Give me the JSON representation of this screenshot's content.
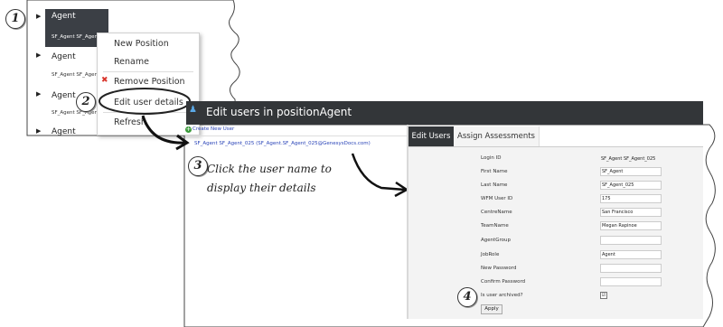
{
  "steps": {
    "one": "1",
    "two": "2",
    "three": "3",
    "four": "4"
  },
  "tree": {
    "items": [
      {
        "label": "Agent",
        "sub": "SF_Agent SF_Agent"
      },
      {
        "label": "Agent",
        "sub": "SF_Agent SF_Agent"
      },
      {
        "label": "Agent",
        "sub": "SF_Agent SF_Agent"
      },
      {
        "label": "Agent"
      }
    ]
  },
  "context_menu": {
    "items": [
      "New Position",
      "Rename",
      "Remove Position",
      "Edit user details",
      "Refresh"
    ]
  },
  "dialog": {
    "title": "Edit users in positionAgent",
    "create_user": "Create New User",
    "user_link": "SF_Agent SF_Agent_025 (SF_Agent.SF_Agent_025@GenesysDocs.com)",
    "tabs": [
      "Edit Users",
      "Assign Assessments"
    ]
  },
  "annotation": {
    "line1": "Click the user name to",
    "line2": "display their details"
  },
  "form": {
    "login_id_label": "Login ID",
    "login_id_value": "SF_Agent SF_Agent_025",
    "fields": [
      {
        "label": "First Name",
        "value": "SF_Agent"
      },
      {
        "label": "Last Name",
        "value": "SF_Agent_025"
      },
      {
        "label": "WFM User ID",
        "value": "175"
      },
      {
        "label": "CentreName",
        "value": "San Francisco"
      },
      {
        "label": "TeamName",
        "value": "Megan Rapinoe"
      },
      {
        "label": "AgentGroup",
        "value": ""
      },
      {
        "label": "JobRole",
        "value": "Agent"
      },
      {
        "label": "New Password",
        "value": ""
      },
      {
        "label": "Confirm Password",
        "value": ""
      }
    ],
    "archived_label": "Is user archived?",
    "archived_check": "☑",
    "apply": "Apply"
  },
  "colors": {
    "header": "#333639",
    "selected_node": "#3b3f45",
    "link": "#2a44b8",
    "remove_icon": "#d9342b"
  }
}
